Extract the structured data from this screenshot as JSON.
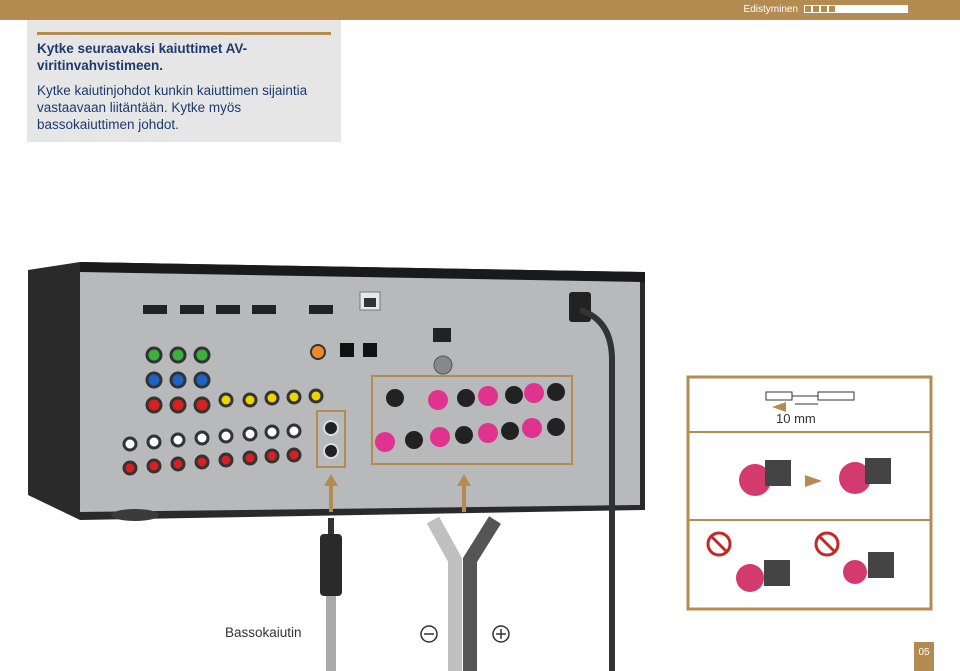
{
  "header": {
    "section_label": "Edistyminen",
    "progress_total": 13,
    "progress_done": 4
  },
  "instructions": {
    "title": "Kytke seuraavaksi kaiuttimet AV-viritinvahvistimeen.",
    "body": "Kytke kaiutinjohdot kunkin kaiuttimen sijaintia vastaavaan liitäntään. Kytke myös bassokaiuttimen johdot."
  },
  "captions": {
    "subwoofer": "Bassokaiutin",
    "strip_length": "10 mm"
  },
  "page_number": "05",
  "colors": {
    "accent": "#b48c52",
    "text": "#1e3a6e",
    "panel": "#e6e6e6"
  }
}
